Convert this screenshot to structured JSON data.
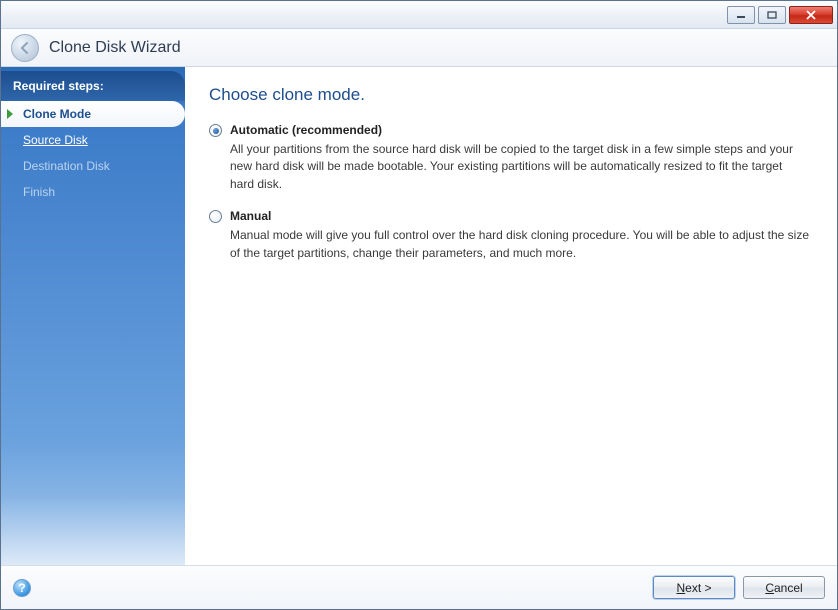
{
  "window": {
    "title": "Clone Disk Wizard"
  },
  "sidebar": {
    "header": "Required steps:",
    "steps": {
      "clone_mode": "Clone Mode",
      "source_disk": "Source Disk",
      "destination_disk": "Destination Disk",
      "finish": "Finish"
    }
  },
  "main": {
    "heading": "Choose clone mode.",
    "auto": {
      "label": "Automatic (recommended)",
      "desc": "All your partitions from the source hard disk will be copied to the target disk in a few simple steps and your new hard disk will be made bootable. Your existing partitions will be automatically resized to fit the target hard disk."
    },
    "manual": {
      "label": "Manual",
      "desc": "Manual mode will give you full control over the hard disk cloning procedure. You will be able to adjust the size of the target partitions, change their parameters, and much more."
    }
  },
  "footer": {
    "help_symbol": "?",
    "next_prefix": "N",
    "next_suffix": "ext >",
    "cancel_prefix": "C",
    "cancel_suffix": "ancel"
  }
}
